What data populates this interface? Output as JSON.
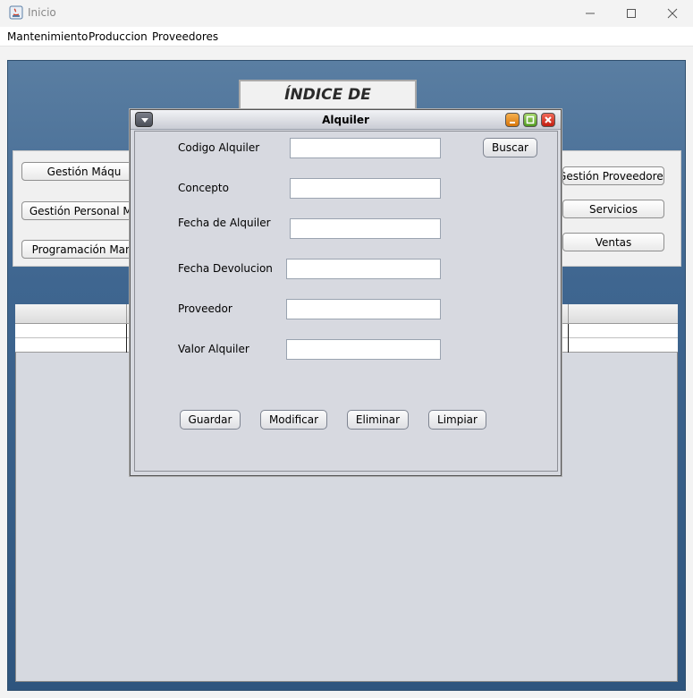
{
  "window": {
    "title": "Inicio"
  },
  "menu": [
    "Mantenimiento",
    "Produccion",
    "Proveedores"
  ],
  "desktop": {
    "heading": "ÍNDICE DE BÚSQUEDA",
    "left_buttons": [
      "Gestión Máqu",
      "Gestión Personal  Ma",
      "Programación Mant"
    ],
    "right_buttons": [
      "Gestión Proveedores",
      "Servicios",
      "Ventas"
    ]
  },
  "dialog": {
    "title": "Alquiler",
    "fields": [
      {
        "label": "Codigo Alquiler",
        "value": ""
      },
      {
        "label": "Concepto",
        "value": ""
      },
      {
        "label": "Fecha de Alquiler",
        "value": ""
      },
      {
        "label": "Fecha Devolucion",
        "value": ""
      },
      {
        "label": "Proveedor",
        "value": ""
      },
      {
        "label": "Valor Alquiler",
        "value": ""
      }
    ],
    "search_button": "Buscar",
    "actions": [
      "Guardar",
      "Modificar",
      "Eliminar",
      "Limpiar"
    ]
  }
}
